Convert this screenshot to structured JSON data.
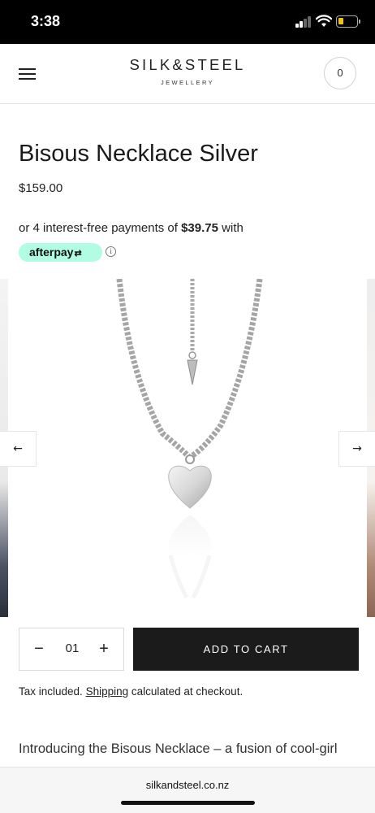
{
  "status_bar": {
    "time": "3:38"
  },
  "header": {
    "logo_main": "SILK&STEEL",
    "logo_sub": "JEWELLERY",
    "cart_count": "0"
  },
  "product": {
    "title": "Bisous Necklace Silver",
    "price": "$159.00",
    "installments_prefix": "or 4 interest-free payments of ",
    "installment_amount": "$39.75",
    "installments_suffix": " with",
    "afterpay_label": "afterpay",
    "info_symbol": "i"
  },
  "gallery": {
    "prev_arrow": "←",
    "next_arrow": "→"
  },
  "purchase": {
    "qty_minus": "−",
    "qty_value": "01",
    "qty_plus": "+",
    "add_to_cart": "ADD TO CART"
  },
  "tax_note": {
    "prefix": "Tax included. ",
    "link": "Shipping",
    "suffix": " calculated at checkout."
  },
  "description_intro": "Introducing the Bisous Necklace – a fusion of cool-girl",
  "browser": {
    "url": "silkandsteel.co.nz"
  },
  "colors": {
    "afterpay_mint": "#b2fce4",
    "cart_button": "#1b1b1b",
    "battery_yellow": "#f3c500"
  }
}
